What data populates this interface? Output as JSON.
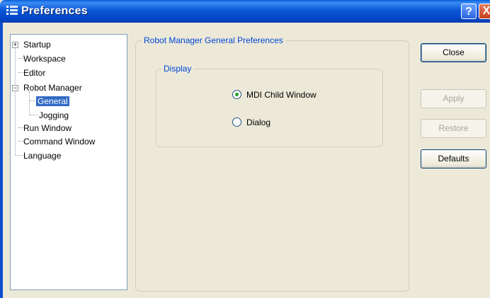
{
  "window": {
    "title": "Preferences"
  },
  "titlebar": {
    "help_label": "?",
    "close_label": "X"
  },
  "tree": {
    "items": [
      {
        "label": "Startup",
        "expander": "+"
      },
      {
        "label": "Workspace"
      },
      {
        "label": "Editor"
      },
      {
        "label": "Robot Manager",
        "expander": "−"
      },
      {
        "label": "General",
        "selected": true
      },
      {
        "label": "Jogging"
      },
      {
        "label": "Run Window"
      },
      {
        "label": "Command Window"
      },
      {
        "label": "Language"
      }
    ]
  },
  "main": {
    "group_title": "Robot Manager General Preferences",
    "display_group": {
      "title": "Display",
      "options": [
        {
          "label": "MDI Child Window",
          "checked": true
        },
        {
          "label": "Dialog",
          "checked": false
        }
      ]
    }
  },
  "buttons": {
    "close": "Close",
    "apply": "Apply",
    "restore": "Restore",
    "defaults": "Defaults"
  },
  "colors": {
    "selected": "#316ac5",
    "group_title": "#0046d5",
    "radio_dot": "#21a121"
  }
}
